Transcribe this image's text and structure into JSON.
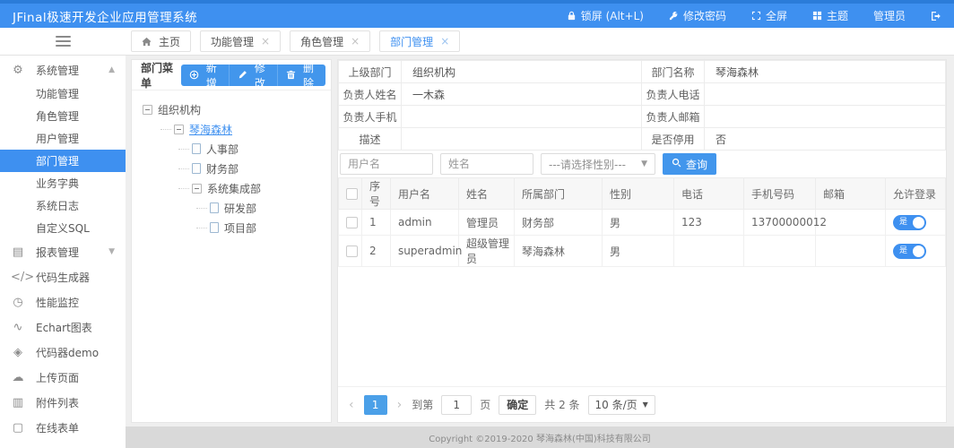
{
  "topbar": {
    "title": "JFinal极速开发企业应用管理系统",
    "menu": [
      {
        "id": "lock-screen",
        "icon": "lock-icon",
        "label": "锁屏 (Alt+L)"
      },
      {
        "id": "change-password",
        "icon": "key-icon",
        "label": "修改密码"
      },
      {
        "id": "fullscreen",
        "icon": "fullscreen-icon",
        "label": "全屏"
      },
      {
        "id": "theme",
        "icon": "theme-icon",
        "label": "主题"
      },
      {
        "id": "current-user",
        "icon": null,
        "label": "管理员"
      },
      {
        "id": "logout",
        "icon": "logout-icon",
        "label": ""
      }
    ]
  },
  "tabs": [
    {
      "id": "home",
      "label": "主页",
      "icon": "home-icon",
      "closable": false,
      "active": false
    },
    {
      "id": "function-mgmt",
      "label": "功能管理",
      "closable": true,
      "active": false
    },
    {
      "id": "role-mgmt",
      "label": "角色管理",
      "closable": true,
      "active": false
    },
    {
      "id": "dept-mgmt",
      "label": "部门管理",
      "closable": true,
      "active": true
    }
  ],
  "sidebar": {
    "items": [
      {
        "id": "system-mgmt",
        "label": "系统管理",
        "icon": "gear-icon",
        "type": "group",
        "arrow": "up"
      },
      {
        "id": "function-mgmt",
        "label": "功能管理",
        "type": "child"
      },
      {
        "id": "role-mgmt",
        "label": "角色管理",
        "type": "child"
      },
      {
        "id": "user-mgmt",
        "label": "用户管理",
        "type": "child"
      },
      {
        "id": "dept-mgmt",
        "label": "部门管理",
        "type": "child",
        "active": true
      },
      {
        "id": "business-dict",
        "label": "业务字典",
        "type": "child"
      },
      {
        "id": "system-log",
        "label": "系统日志",
        "type": "child"
      },
      {
        "id": "custom-sql",
        "label": "自定义SQL",
        "type": "child"
      },
      {
        "id": "report-mgmt",
        "label": "报表管理",
        "icon": "report-icon",
        "type": "group",
        "arrow": "down"
      },
      {
        "id": "code-generator",
        "label": "代码生成器",
        "icon": "code-icon",
        "type": "item"
      },
      {
        "id": "performance-monitor",
        "label": "性能监控",
        "icon": "monitor-icon",
        "type": "item"
      },
      {
        "id": "echart-charts",
        "label": "Echart图表",
        "icon": "chart-icon",
        "type": "item"
      },
      {
        "id": "code-demo",
        "label": "代码器demo",
        "icon": "demo-icon",
        "type": "item"
      },
      {
        "id": "upload-page",
        "label": "上传页面",
        "icon": "upload-icon",
        "type": "item"
      },
      {
        "id": "attachment-list",
        "label": "附件列表",
        "icon": "attachment-icon",
        "type": "item"
      },
      {
        "id": "online-form",
        "label": "在线表单",
        "icon": "form-icon",
        "type": "item"
      }
    ]
  },
  "tree_panel": {
    "title": "部门菜单",
    "buttons": [
      {
        "id": "add",
        "label": "新增",
        "icon": "plus-icon"
      },
      {
        "id": "edit",
        "label": "修改",
        "icon": "pencil-icon"
      },
      {
        "id": "delete",
        "label": "删除",
        "icon": "trash-icon"
      }
    ],
    "nodes": [
      {
        "label": "组织机构",
        "level": 0,
        "type": "branch",
        "selected": false
      },
      {
        "label": "琴海森林",
        "level": 1,
        "type": "branch",
        "selected": true
      },
      {
        "label": "人事部",
        "level": 2,
        "type": "leaf",
        "selected": false
      },
      {
        "label": "财务部",
        "level": 2,
        "type": "leaf",
        "selected": false
      },
      {
        "label": "系统集成部",
        "level": 2,
        "type": "branch",
        "selected": false
      },
      {
        "label": "研发部",
        "level": 3,
        "type": "leaf",
        "selected": false
      },
      {
        "label": "项目部",
        "level": 3,
        "type": "leaf",
        "selected": false
      }
    ]
  },
  "form": {
    "rows": [
      [
        {
          "label": "上级部门",
          "value": "组织机构"
        },
        {
          "label": "部门名称",
          "value": "琴海森林"
        }
      ],
      [
        {
          "label": "负责人姓名",
          "value": "一木森"
        },
        {
          "label": "负责人电话",
          "value": ""
        }
      ],
      [
        {
          "label": "负责人手机",
          "value": ""
        },
        {
          "label": "负责人邮箱",
          "value": ""
        }
      ],
      [
        {
          "label": "描述",
          "value": ""
        },
        {
          "label": "是否停用",
          "value": "否"
        }
      ]
    ]
  },
  "search": {
    "username_placeholder": "用户名",
    "name_placeholder": "姓名",
    "gender_option": "---请选择性别---",
    "search_label": "查询"
  },
  "table": {
    "headers": [
      "序号",
      "用户名",
      "姓名",
      "所属部门",
      "性别",
      "电话",
      "手机号码",
      "邮箱",
      "允许登录"
    ],
    "rows": [
      {
        "cells": [
          "1",
          "admin",
          "管理员",
          "财务部",
          "男",
          "123",
          "13700000012",
          ""
        ],
        "login": "是"
      },
      {
        "cells": [
          "2",
          "superadmin",
          "超级管理员",
          "琴海森林",
          "男",
          "",
          "",
          ""
        ],
        "login": "是"
      }
    ]
  },
  "pagination": {
    "current": "1",
    "goto_label": "到第",
    "goto_value": "1",
    "page_label": "页",
    "confirm_label": "确定",
    "total_label": "共 2 条",
    "per_page_label": "10 条/页"
  },
  "footer": "Copyright ©2019-2020 琴海森林(中国)科技有限公司"
}
